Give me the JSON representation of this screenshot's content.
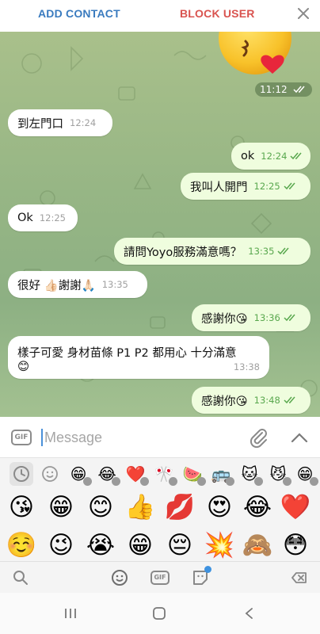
{
  "topbar": {
    "add_contact": "ADD CONTACT",
    "block_user": "BLOCK USER",
    "close_icon": "close-icon"
  },
  "sticker": {
    "time": "11:12",
    "icon": "kissing-face-sticker"
  },
  "messages": [
    {
      "dir": "in",
      "text": "到左門口",
      "time": "12:24"
    },
    {
      "dir": "out",
      "text": "ok",
      "time": "12:24"
    },
    {
      "dir": "out",
      "text": "我叫人開門",
      "time": "12:25"
    },
    {
      "dir": "in",
      "text": "Ok",
      "time": "12:25"
    },
    {
      "dir": "out",
      "text": "請問Yoyo服務滿意嗎？",
      "time": "13:35"
    },
    {
      "dir": "in",
      "text": "很好 👍🏻謝謝🙏🏻",
      "time": "13:35"
    },
    {
      "dir": "out",
      "text": "感謝你😘",
      "time": "13:36"
    },
    {
      "dir": "in",
      "text": "樣子可愛 身材苗條 P1 P2 都用心 十分滿意",
      "text2": "😊",
      "time": "13:38"
    },
    {
      "dir": "out",
      "text": "感謝你😘",
      "time": "13:48"
    }
  ],
  "composer": {
    "placeholder": "Message",
    "gif_label": "GIF"
  },
  "emoji_categories": [
    "🕒",
    "☺",
    "😁",
    "😂",
    "❤️",
    "🎌",
    "🍉",
    "🚌",
    "🐱",
    "😼",
    "😁"
  ],
  "emoji_rows": [
    [
      "😘",
      "😁",
      "😊",
      "👍",
      "💋",
      "😍",
      "😂",
      "❤️"
    ],
    [
      "☺️",
      "😉",
      "😭",
      "😁",
      "😔",
      "💥",
      "🙈",
      "😳"
    ]
  ],
  "toolbar": {
    "gif_label": "GIF"
  },
  "colors": {
    "accent": "#3a7bbf",
    "danger": "#d9534f",
    "outgoing": "#effdde",
    "check": "#59a84e"
  }
}
